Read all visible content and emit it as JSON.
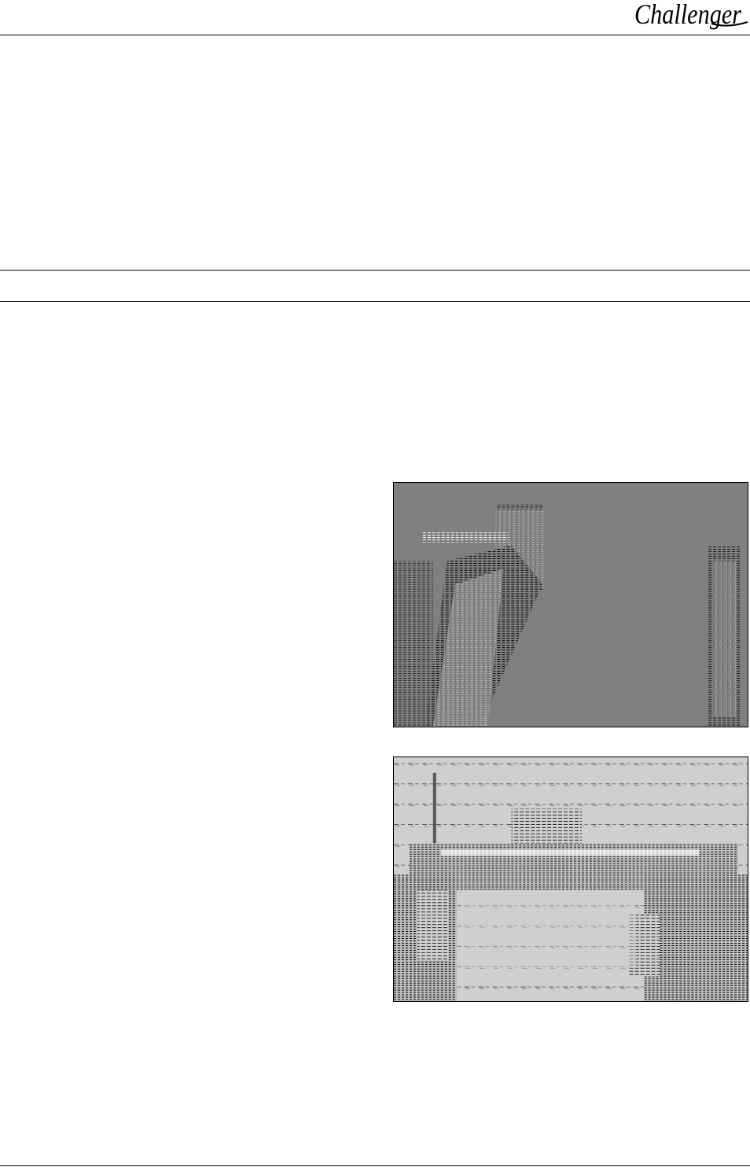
{
  "header": {
    "brand_logo_text": "Challenger"
  },
  "figures": [
    {
      "id": "photo-machine-side"
    },
    {
      "id": "photo-machine-rear"
    }
  ]
}
